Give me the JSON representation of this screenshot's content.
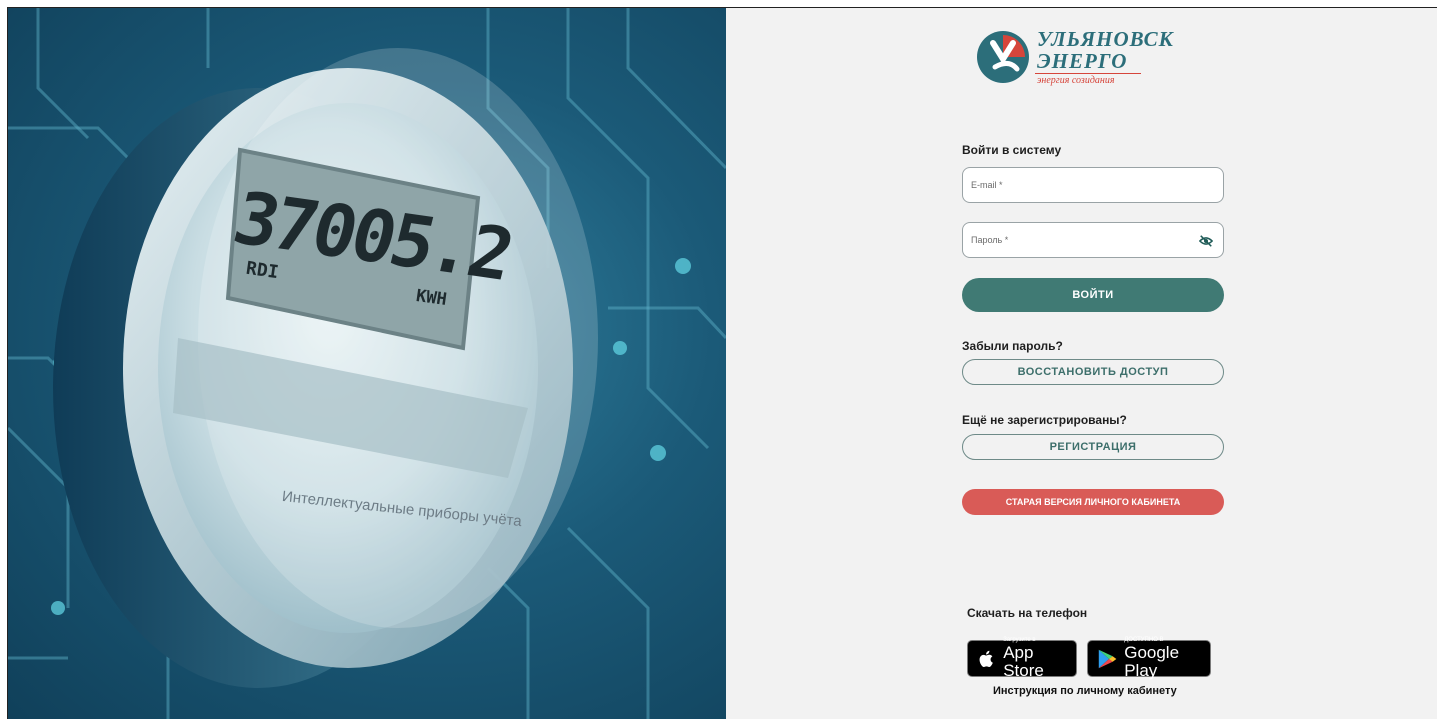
{
  "hero": {
    "lcd_value": "37005.2",
    "lcd_mode": "RDI",
    "lcd_unit": "КWH",
    "caption": "Интеллектуальные приборы учёта"
  },
  "logo": {
    "line1": "УЛЬЯНОВСК",
    "line2": "ЭНЕРГО",
    "tagline": "энергия созидания"
  },
  "login": {
    "title": "Войти в систему",
    "email_placeholder": "E-mail *",
    "password_placeholder": "Пароль *",
    "submit_label": "ВОЙТИ"
  },
  "recovery": {
    "prompt": "Забыли пароль?",
    "button_label": "ВОССТАНОВИТЬ ДОСТУП"
  },
  "register": {
    "prompt": "Ещё не зарегистрированы?",
    "button_label": "РЕГИСТРАЦИЯ"
  },
  "old_version": {
    "button_label": "СТАРАЯ ВЕРСИЯ ЛИЧНОГО КАБИНЕТА"
  },
  "mobile": {
    "title": "Скачать на телефон",
    "appstore_small": "Загрузите в",
    "appstore_big": "App Store",
    "googleplay_small": "ДОСТУПНО В",
    "googleplay_big": "Google Play",
    "instruction": "Инструкция по личному кабинету"
  },
  "colors": {
    "primary": "#407a74",
    "danger": "#d95b57",
    "logo_teal": "#2c6e7a",
    "logo_red": "#d6453b",
    "panel_bg": "#f2f2f2"
  }
}
